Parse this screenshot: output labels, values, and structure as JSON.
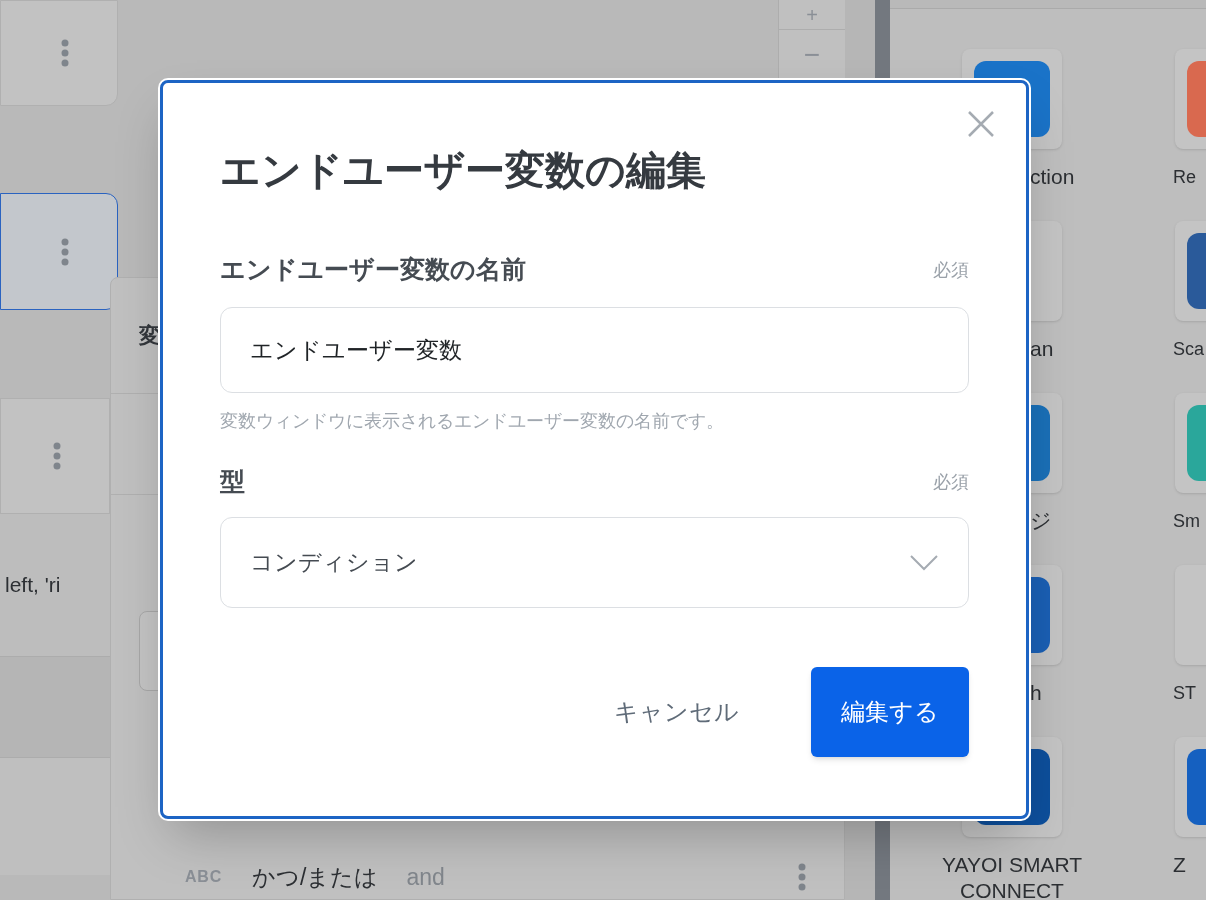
{
  "background": {
    "left_cards": [
      {
        "selected": false
      },
      {
        "selected": true
      },
      {
        "selected": false
      }
    ],
    "left_text": "left, 'ri",
    "zoom_controls": {
      "zoom_in": "+",
      "zoom_out": "−"
    },
    "variables_panel": {
      "title": "変",
      "rows": [
        {
          "type_badge": "ABC",
          "name": "かつ/または",
          "value": "and"
        }
      ]
    },
    "apps": [
      {
        "label": "ction",
        "color": "#1a73c8"
      },
      {
        "label": "Re",
        "color": "#d9694f"
      },
      {
        "label": "an"
      },
      {
        "label": "Sca",
        "color": "#2a5a9a"
      },
      {
        "label": "ジ",
        "color": "#1a70b8"
      },
      {
        "label": "Sm",
        "color": "#2aa79b"
      },
      {
        "label": "h",
        "color": "#1a5fb4"
      },
      {
        "label": "ST"
      },
      {
        "label": "YAYOI SMART CONNECT",
        "color": "#0d4f9c"
      },
      {
        "label": "Z",
        "color": "#1560c0"
      }
    ]
  },
  "dialog": {
    "title": "エンドユーザー変数の編集",
    "fields": [
      {
        "kind": "text",
        "label": "エンドユーザー変数の名前",
        "required_mark": "必須",
        "value": "エンドユーザー変数",
        "help": "変数ウィンドウに表示されるエンドユーザー変数の名前です。"
      },
      {
        "kind": "select",
        "label": "型",
        "required_mark": "必須",
        "value": "コンディション"
      }
    ],
    "buttons": [
      {
        "kind": "secondary",
        "label": "キャンセル"
      },
      {
        "kind": "primary",
        "label": "編集する"
      }
    ]
  }
}
